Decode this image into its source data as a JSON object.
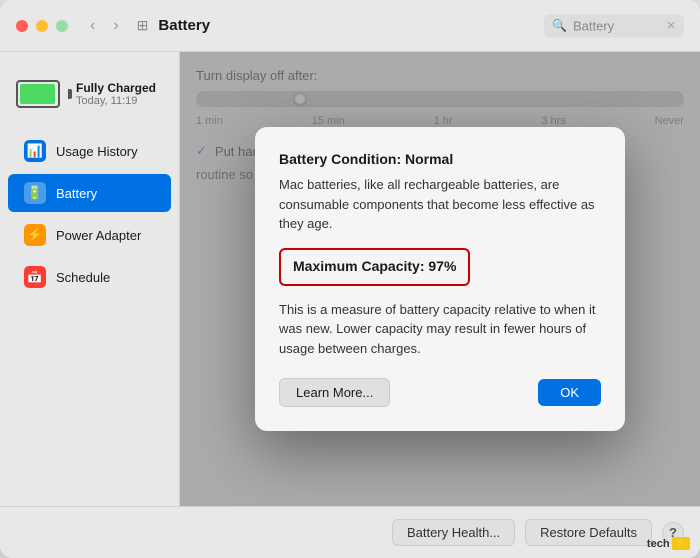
{
  "titlebar": {
    "title": "Battery",
    "search_placeholder": "Battery"
  },
  "sidebar": {
    "battery_status": {
      "label": "Fully Charged",
      "time": "Today, 11:19"
    },
    "items": [
      {
        "id": "usage-history",
        "label": "Usage History",
        "icon": "📊",
        "color": "blue",
        "active": false
      },
      {
        "id": "battery",
        "label": "Battery",
        "icon": "🔋",
        "color": "green",
        "active": true
      },
      {
        "id": "power-adapter",
        "label": "Power Adapter",
        "icon": "⚡",
        "color": "orange",
        "active": false
      },
      {
        "id": "schedule",
        "label": "Schedule",
        "icon": "📅",
        "color": "red",
        "active": false
      }
    ]
  },
  "panel": {
    "display_off_label": "Turn display off after:",
    "slider_labels": [
      "1 min",
      "15 min",
      "1 hr",
      "3 hrs",
      "Never"
    ],
    "hard_disk_label": "Put hard disks to sleep when possible",
    "routine_text": "routine so it can"
  },
  "bottom_bar": {
    "battery_health_label": "Battery Health...",
    "restore_defaults_label": "Restore Defaults",
    "help_label": "?"
  },
  "modal": {
    "title": "Battery Condition: Normal",
    "description": "Mac batteries, like all rechargeable batteries, are consumable components that become less effective as they age.",
    "capacity_label": "Maximum Capacity: 97%",
    "capacity_description": "This is a measure of battery capacity relative to when it was new. Lower capacity may result in fewer hours of usage between charges.",
    "learn_more_label": "Learn More...",
    "ok_label": "OK"
  },
  "watermark": {
    "text": "tech",
    "bolt": "⚡"
  }
}
